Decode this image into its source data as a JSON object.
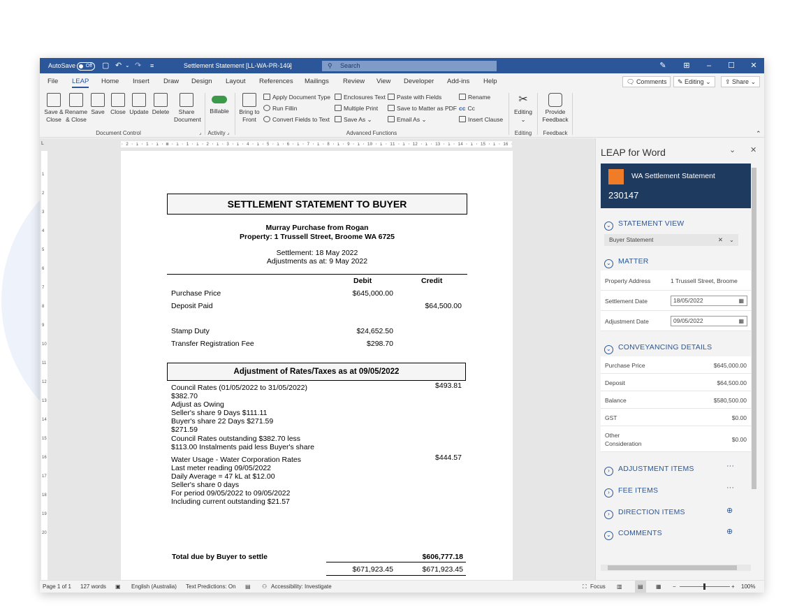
{
  "titlebar": {
    "autosave_label": "AutoSave",
    "autosave_state": "Off",
    "doc_title": "Settlement Statement [LL-WA-PR-140]",
    "search_placeholder": "Search"
  },
  "menu": {
    "tabs": [
      "File",
      "LEAP",
      "Home",
      "Insert",
      "Draw",
      "Design",
      "Layout",
      "References",
      "Mailings",
      "Review",
      "View",
      "Developer",
      "Add-ins",
      "Help"
    ],
    "active_tab": "LEAP",
    "comments_label": "Comments",
    "editing_label": "Editing",
    "share_label": "Share"
  },
  "ribbon": {
    "document_control": {
      "label": "Document Control",
      "buttons": [
        "Save & Close",
        "Rename & Close",
        "Save",
        "Close",
        "Update",
        "Delete",
        "Share Document"
      ]
    },
    "activity": {
      "label": "Activity",
      "billable": "Billable"
    },
    "advanced": {
      "label": "Advanced Functions",
      "bring_to_front": "Bring to Front",
      "items": [
        "Apply Document Type",
        "Run Fillin",
        "Convert Fields to Text",
        "Enclosures Text",
        "Multiple Print",
        "Save As",
        "Paste with Fields",
        "Save to Matter as PDF",
        "Email As",
        "Rename",
        "Cc",
        "Insert Clause"
      ]
    },
    "editing": {
      "label": "Editing",
      "button": "Editing"
    },
    "feedback": {
      "label": "Feedback",
      "button": "Provide Feedback"
    }
  },
  "document": {
    "heading": "SETTLEMENT STATEMENT TO BUYER",
    "parties": "Murray Purchase from Rogan",
    "property": "Property: 1 Trussell Street, Broome WA 6725",
    "settlement": "Settlement: 18 May 2022",
    "adjustments_as_at": "Adjustments as at: 9 May 2022",
    "col_debit": "Debit",
    "col_credit": "Credit",
    "lines": [
      {
        "label": "Purchase Price",
        "debit": "$645,000.00",
        "credit": ""
      },
      {
        "label": "Deposit Paid",
        "debit": "",
        "credit": "$64,500.00"
      },
      {
        "label": "Stamp Duty",
        "debit": "$24,652.50",
        "credit": ""
      },
      {
        "label": "Transfer Registration Fee",
        "debit": "$298.70",
        "credit": ""
      }
    ],
    "adj_heading": "Adjustment of Rates/Taxes as at 09/05/2022",
    "council": {
      "amount": "$493.81",
      "lines": [
        "Council Rates (01/05/2022 to 31/05/2022)",
        "$382.70",
        "Adjust as Owing",
        "Seller's share 9 Days $111.11",
        "Buyer's share 22 Days $271.59",
        "$271.59",
        "Council Rates outstanding $382.70 less",
        "$113.00 Instalments paid less Buyer's share"
      ]
    },
    "water": {
      "amount": "$444.57",
      "lines": [
        "Water Usage - Water Corporation Rates",
        "Last meter reading 09/05/2022",
        "Daily Average = 47 kL at $12.00",
        "Seller's share 0 days",
        "For period 09/05/2022 to 09/05/2022",
        "Including current outstanding $21.57"
      ]
    },
    "total_label": "Total due by Buyer to settle",
    "total_credit": "$606,777.18",
    "sum_debit": "$671,923.45",
    "sum_credit": "$671,923.45"
  },
  "statusbar": {
    "page": "Page 1 of 1",
    "words": "127 words",
    "language": "English (Australia)",
    "predictions": "Text Predictions: On",
    "accessibility": "Accessibility: Investigate",
    "focus": "Focus",
    "zoom": "100%"
  },
  "panel": {
    "title": "LEAP for Word",
    "card_title": "WA Settlement Statement",
    "card_number": "230147",
    "statement_view": "STATEMENT VIEW",
    "statement_select": "Buyer Statement",
    "matter": "MATTER",
    "property_address_label": "Property Address",
    "property_address": "1 Trussell Street, Broome",
    "settlement_date_label": "Settlement Date",
    "settlement_date": "18/05/2022",
    "adjustment_date_label": "Adjustment Date",
    "adjustment_date": "09/05/2022",
    "conveyancing": "CONVEYANCING DETAILS",
    "conveyancing_rows": [
      {
        "label": "Purchase Price",
        "value": "$645,000.00"
      },
      {
        "label": "Deposit",
        "value": "$64,500.00"
      },
      {
        "label": "Balance",
        "value": "$580,500.00"
      },
      {
        "label": "GST",
        "value": "$0.00"
      }
    ],
    "other_label_1": "Other",
    "other_label_2": "Consideration",
    "other_value": "$0.00",
    "adjustment_items": "ADJUSTMENT ITEMS",
    "fee_items": "FEE ITEMS",
    "direction_items": "DIRECTION ITEMS",
    "comments": "COMMENTS"
  }
}
